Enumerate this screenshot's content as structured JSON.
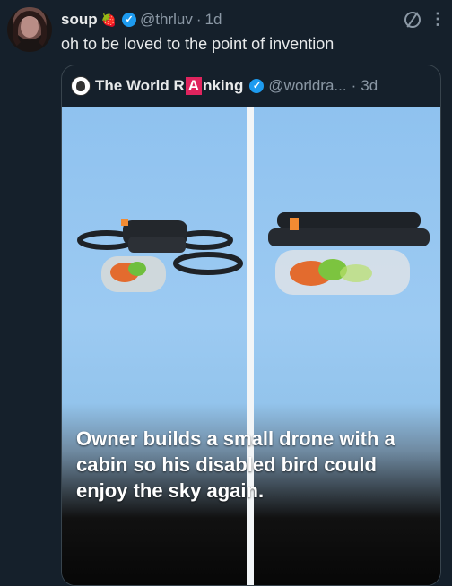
{
  "author": {
    "name": "soup",
    "emoji": "🍓",
    "handle": "@thrluv",
    "separator": "·",
    "time": "1d",
    "text": "oh to be loved to the point of invention"
  },
  "quoted": {
    "brand_prefix": "The World R",
    "brand_highlight": "A",
    "brand_suffix": "nking",
    "handle": "@worldra...",
    "separator": "·",
    "time": "3d",
    "caption": "Owner builds a small drone with a cabin so his disabled bird could enjoy the sky again."
  },
  "icons": {
    "verified": "verified-badge-icon",
    "grok": "grok-icon",
    "more": "more-options-icon"
  },
  "colors": {
    "background": "#15202b",
    "verified": "#1d9bf0",
    "muted": "#8b98a5"
  }
}
